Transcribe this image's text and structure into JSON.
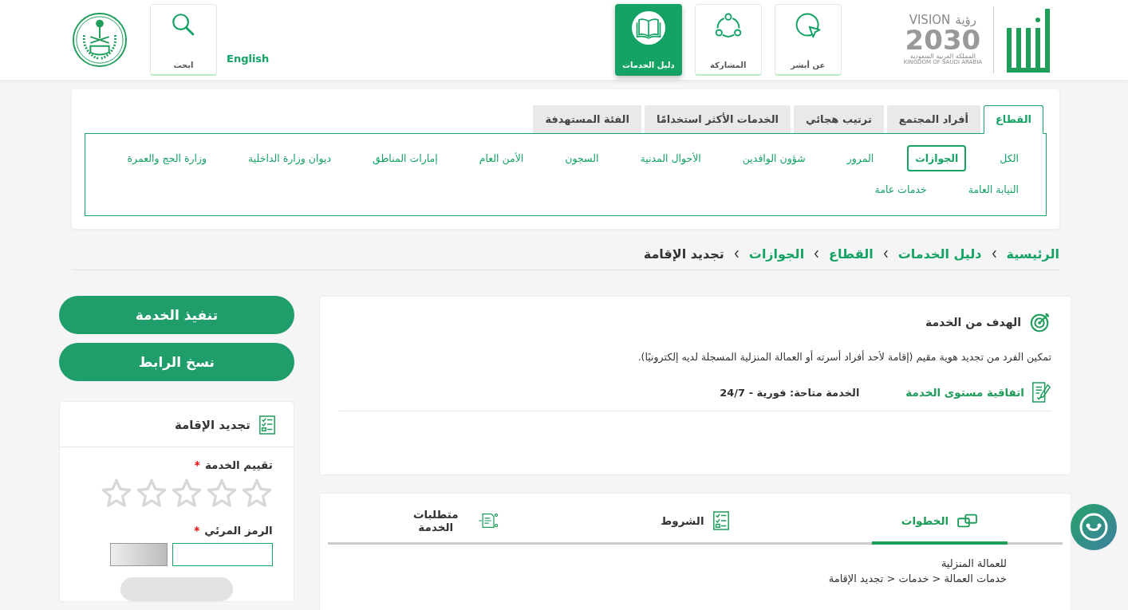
{
  "header": {
    "vision": {
      "word_en": "VISION",
      "word_ar": "رؤية",
      "year": "2030",
      "country_ar": "المملكة العربية السعودية",
      "country_en": "KINGDOM OF SAUDI ARABIA"
    },
    "nav": [
      {
        "kind": "about",
        "label": "عن أبشر",
        "selected": false
      },
      {
        "kind": "participation",
        "label": "المشاركة",
        "selected": false
      },
      {
        "kind": "guide",
        "label": "دليل الخدمات",
        "selected": true
      }
    ],
    "language_link": "English",
    "search": {
      "label": "ابحث"
    }
  },
  "category_tabs": [
    {
      "label": "القطاع",
      "selected": true
    },
    {
      "label": "أفراد المجتمع",
      "selected": false
    },
    {
      "label": "ترتيب هجائي",
      "selected": false
    },
    {
      "label": "الخدمات الأكثر استخدامًا",
      "selected": false
    },
    {
      "label": "الفئة المستهدفة",
      "selected": false
    }
  ],
  "sectors": [
    {
      "label": "الكل",
      "selected": false
    },
    {
      "label": "الجوازات",
      "selected": true
    },
    {
      "label": "المرور",
      "selected": false
    },
    {
      "label": "شؤون الوافدين",
      "selected": false
    },
    {
      "label": "الأحوال المدنية",
      "selected": false
    },
    {
      "label": "السجون",
      "selected": false
    },
    {
      "label": "الأمن العام",
      "selected": false
    },
    {
      "label": "إمارات المناطق",
      "selected": false
    },
    {
      "label": "ديوان وزارة الداخلية",
      "selected": false
    },
    {
      "label": "وزارة الحج والعمرة",
      "selected": false
    },
    {
      "label": "النيابة العامة",
      "selected": false
    },
    {
      "label": "خدمات عامة",
      "selected": false
    }
  ],
  "breadcrumb": [
    "الرئيسية",
    "دليل الخدمات",
    "القطاع",
    "الجوازات",
    "تجديد الإقامة"
  ],
  "goal": {
    "title": "الهدف من الخدمة",
    "text": "تمكين الفرد من تجديد هوية مقيم (إقامة لأحد أفراد أسرته أو العمالة المنزلية المسجلة لديه إلكترونيًا).",
    "sla_link": "اتفاقية مستوى الخدمة",
    "availability": "الخدمة متاحة: فورية - 24/7"
  },
  "detail_tabs": [
    {
      "kind": "steps",
      "label": "الخطوات",
      "selected": true
    },
    {
      "kind": "terms",
      "label": "الشروط",
      "selected": false
    },
    {
      "kind": "requirements",
      "label": "متطلبات الخدمة",
      "selected": false
    }
  ],
  "steps_lines": [
    "للعمالة المنزلية",
    "خدمات العمالة < خدمات < تجديد الإقامة"
  ],
  "actions": [
    "تنفيذ الخدمة",
    "نسخ الرابط"
  ],
  "rating_card": {
    "title": "تجديد الإقامة",
    "rating_label": "تقييم الخدمة",
    "required_mark": "*",
    "stars": 0,
    "captcha_label": "الرمز المرئي",
    "captcha_required_mark": "*"
  }
}
